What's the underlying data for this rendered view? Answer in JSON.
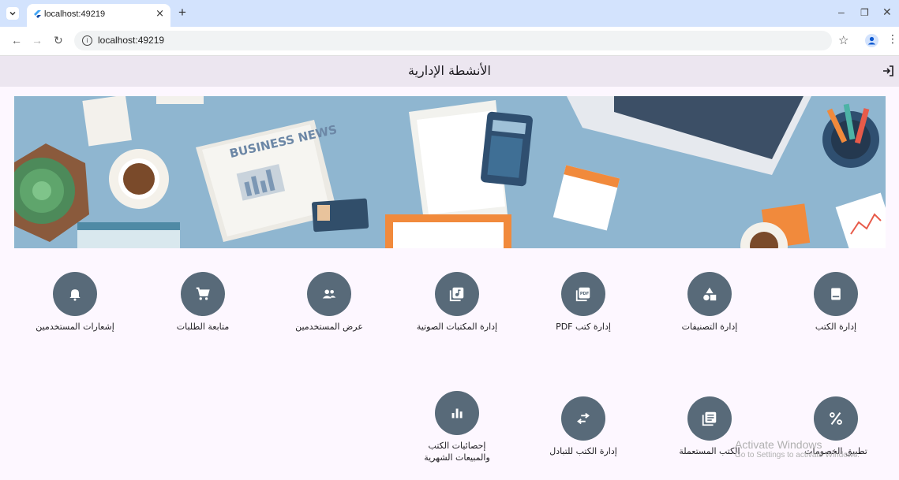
{
  "browser": {
    "tab_title": "localhost:49219",
    "url": "localhost:49219"
  },
  "app": {
    "title": "الأنشطة الإدارية"
  },
  "banner": {
    "newspaper_headline": "BUSINESS NEWS"
  },
  "grid_items": [
    {
      "label": "إدارة الكتب",
      "icon": "book-icon"
    },
    {
      "label": "إدارة التصنيفات",
      "icon": "category-icon"
    },
    {
      "label": "إدارة كتب PDF",
      "icon": "pdf-icon"
    },
    {
      "label": "إدارة المكتبات الصوتية",
      "icon": "audio-library-icon"
    },
    {
      "label": "عرض المستخدمين",
      "icon": "people-icon"
    },
    {
      "label": "متابعة الطلبات",
      "icon": "cart-icon"
    },
    {
      "label": "إشعارات المستخدمين",
      "icon": "bell-icon"
    },
    {
      "label": "تطبيق الخصومات",
      "icon": "percent-icon"
    },
    {
      "label": "الكتب المستعملة",
      "icon": "library-books-icon"
    },
    {
      "label": "إدارة الكتب للتبادل",
      "icon": "swap-icon"
    },
    {
      "label": "إحصائيات الكتب والمبيعات الشهرية",
      "icon": "bar-chart-icon"
    }
  ],
  "watermark": {
    "line1": "Activate Windows",
    "line2": "Go to Settings to activate Windows."
  },
  "colors": {
    "icon_circle": "#586a79",
    "appbar": "#ece6f0",
    "background": "#fdf7ff"
  }
}
